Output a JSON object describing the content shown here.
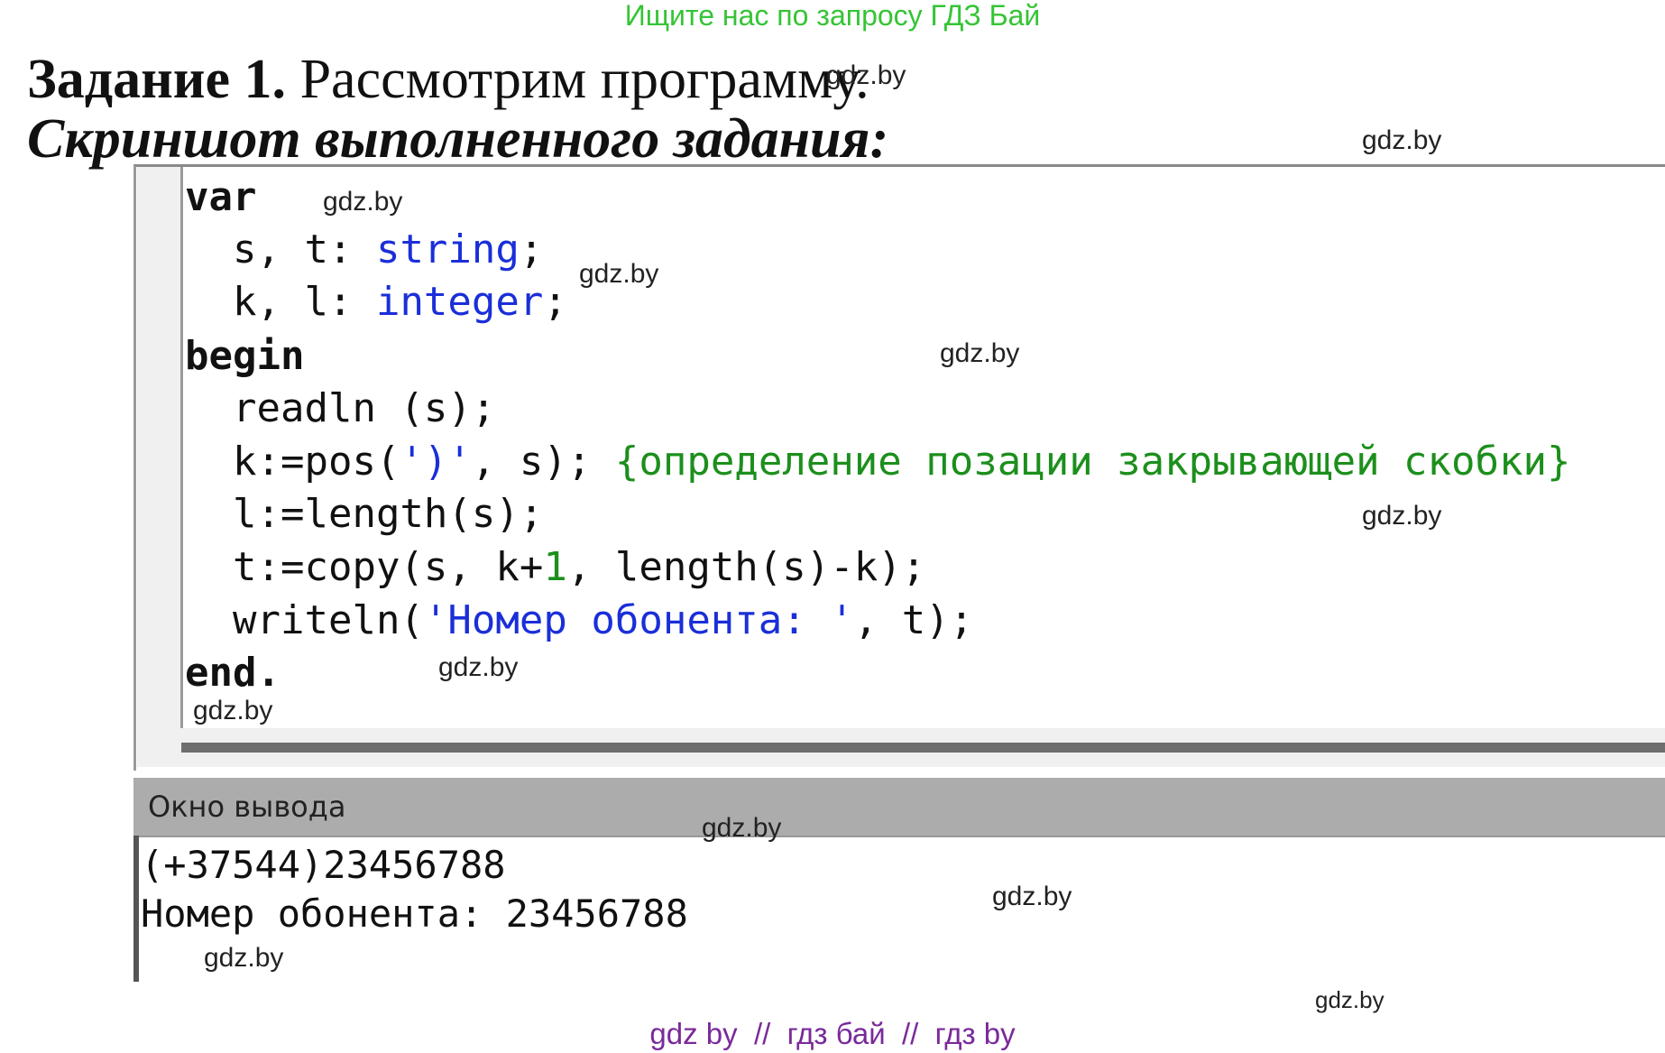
{
  "banner": "Ищите нас по запросу ГДЗ Бай",
  "task": {
    "number_label": "Задание 1.",
    "text": "Рассмотрим программу."
  },
  "screenshot_heading": "Скриншот выполненного задания:",
  "code": {
    "line1": "var",
    "line2": {
      "vars": "s, t: ",
      "type": "string",
      "end": ";"
    },
    "line3": {
      "vars": "k, l: ",
      "type": "integer",
      "end": ";"
    },
    "line4": "begin",
    "line5": "readln (s);",
    "line6": {
      "pre": "k:=pos(",
      "str": "')'",
      "post": ", s); ",
      "comment": "{определение позации закрывающей скобки}"
    },
    "line7": "l:=length(s);",
    "line8": {
      "pre": "t:=copy(s, k+",
      "num": "1",
      "post": ", length(s)-k);"
    },
    "line9": {
      "pre": "writeln(",
      "str": "'Номер обонента: '",
      "post": ", t);"
    },
    "line10": "end."
  },
  "output": {
    "title": "Окно вывода",
    "lines": [
      "(+37544)23456788",
      "Номер обонента: 23456788"
    ]
  },
  "watermark": "gdz.by",
  "footer": "gdz by  //  гдз бай  //  гдз by"
}
